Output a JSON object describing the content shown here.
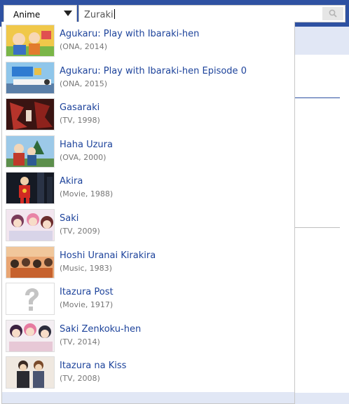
{
  "search": {
    "category": "Anime",
    "query": "Zuraki"
  },
  "results": [
    {
      "title": "Agukaru: Play with Ibaraki-hen",
      "meta": "(ONA, 2014)",
      "thumb": "thumbnail-image"
    },
    {
      "title": "Agukaru: Play with Ibaraki-hen Episode 0",
      "meta": "(ONA, 2015)",
      "thumb": "thumbnail-image"
    },
    {
      "title": "Gasaraki",
      "meta": "(TV, 1998)",
      "thumb": "thumbnail-image"
    },
    {
      "title": "Haha Uzura",
      "meta": "(OVA, 2000)",
      "thumb": "thumbnail-image"
    },
    {
      "title": "Akira",
      "meta": "(Movie, 1988)",
      "thumb": "thumbnail-image"
    },
    {
      "title": "Saki",
      "meta": "(TV, 2009)",
      "thumb": "thumbnail-image"
    },
    {
      "title": "Hoshi Uranai Kirakira",
      "meta": "(Music, 1983)",
      "thumb": "thumbnail-image"
    },
    {
      "title": "Itazura Post",
      "meta": "(Movie, 1917)",
      "thumb": "question-mark-placeholder-icon"
    },
    {
      "title": "Saki Zenkoku-hen",
      "meta": "(TV, 2014)",
      "thumb": "thumbnail-image"
    },
    {
      "title": "Itazura na Kiss",
      "meta": "(TV, 2008)",
      "thumb": "thumbnail-image"
    }
  ],
  "colors": {
    "header": "#2e51a2",
    "link": "#1d439b",
    "meta": "#777777",
    "highlight": "#e1e7f5"
  }
}
